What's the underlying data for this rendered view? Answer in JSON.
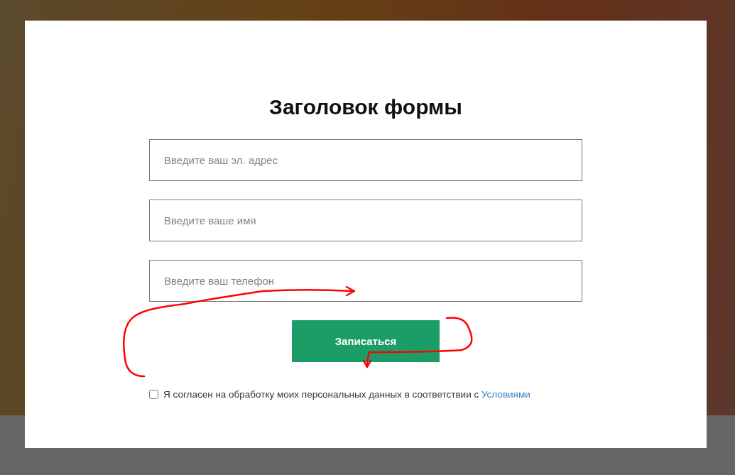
{
  "form": {
    "title": "Заголовок формы",
    "fields": [
      {
        "placeholder": "Введите ваш эл. адрес"
      },
      {
        "placeholder": "Введите ваше имя"
      },
      {
        "placeholder": "Введите ваш телефон"
      }
    ],
    "submit_button": "Записаться",
    "consent": {
      "checked": false,
      "text": "Я согласен на обработку моих персональных данных в соответствии с ",
      "link": "Условиями"
    }
  }
}
